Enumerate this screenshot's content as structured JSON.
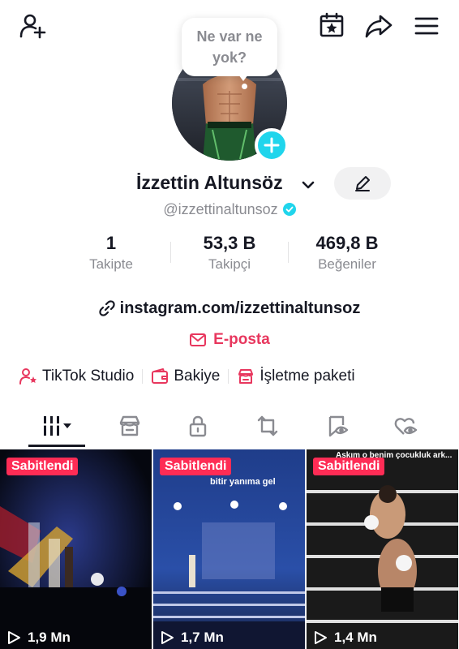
{
  "header": {
    "add_friend_icon": "person-plus-icon",
    "calendar_icon": "calendar-star-icon",
    "share_icon": "share-arrow-icon",
    "menu_icon": "hamburger-menu-icon"
  },
  "profile": {
    "bubble_text": "Ne var ne yok?",
    "name": "İzzettin Altunsöz",
    "handle": "@izzettinaltunsoz",
    "verified": true,
    "edit_icon": "pencil-icon"
  },
  "stats": [
    {
      "value": "1",
      "label": "Takipte"
    },
    {
      "value": "53,3 B",
      "label": "Takipçi"
    },
    {
      "value": "469,8 B",
      "label": "Beğeniler"
    }
  ],
  "bio": {
    "link": "instagram.com/izzettinaltunsoz",
    "email_label": "E-posta"
  },
  "tools": [
    {
      "label": "TikTok Studio",
      "icon": "person-star-icon"
    },
    {
      "label": "Bakiye",
      "icon": "wallet-icon"
    },
    {
      "label": "İşletme paketi",
      "icon": "shop-icon"
    }
  ],
  "tabs": [
    {
      "name": "videos",
      "icon": "grid-bars-icon",
      "active": true
    },
    {
      "name": "shop",
      "icon": "shop-icon"
    },
    {
      "name": "private",
      "icon": "lock-icon"
    },
    {
      "name": "reposts",
      "icon": "repost-icon"
    },
    {
      "name": "favorites",
      "icon": "bookmark-eye-icon"
    },
    {
      "name": "liked",
      "icon": "heart-eye-icon"
    }
  ],
  "videos": [
    {
      "pinned_label": "Sabitlendi",
      "views": "1,9 Mn",
      "overlay": ""
    },
    {
      "pinned_label": "Sabitlendi",
      "views": "1,7 Mn",
      "overlay": "bitir yanıma gel"
    },
    {
      "pinned_label": "Sabitlendi",
      "views": "1,4 Mn",
      "overlay": "Aşkım o benim çocukluk ark..."
    }
  ],
  "colors": {
    "accent": "#fe2c55",
    "email": "#e8375e",
    "verified": "#20d5ec",
    "muted": "#8a8b91",
    "text": "#161823"
  }
}
